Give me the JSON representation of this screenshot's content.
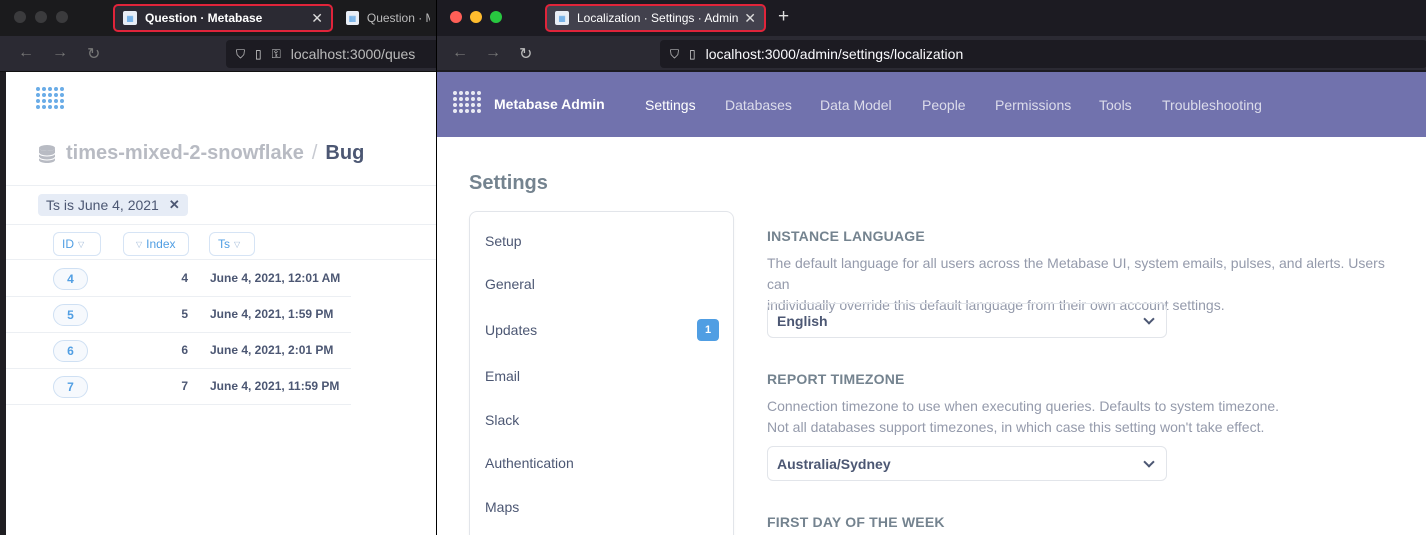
{
  "back_window": {
    "tabs": [
      {
        "label": "Question · Metabase",
        "active": true
      },
      {
        "label": "Question · M",
        "active": false
      }
    ],
    "url": "localhost:3000/ques",
    "breadcrumb": {
      "database": "times-mixed-2-snowflake",
      "separator": "/",
      "question": "Bug"
    },
    "filter": {
      "label": "Ts is June 4, 2021",
      "remove": "✕"
    },
    "columns": [
      {
        "label": "ID"
      },
      {
        "label": "Index"
      },
      {
        "label": "Ts"
      }
    ],
    "rows": [
      {
        "id": "4",
        "index": "4",
        "ts": "June 4, 2021, 12:01 AM"
      },
      {
        "id": "5",
        "index": "5",
        "ts": "June 4, 2021, 1:59 PM"
      },
      {
        "id": "6",
        "index": "6",
        "ts": "June 4, 2021, 2:01 PM"
      },
      {
        "id": "7",
        "index": "7",
        "ts": "June 4, 2021, 11:59 PM"
      }
    ]
  },
  "front_window": {
    "tab": {
      "label": "Localization · Settings · Admin ·",
      "close": "✕"
    },
    "new_tab": "+",
    "url": "localhost:3000/admin/settings/localization",
    "header": {
      "title": "Metabase Admin",
      "nav": [
        "Settings",
        "Databases",
        "Data Model",
        "People",
        "Permissions",
        "Tools",
        "Troubleshooting"
      ],
      "active_nav": "Settings"
    },
    "page_title": "Settings",
    "sidebar": [
      {
        "label": "Setup"
      },
      {
        "label": "General"
      },
      {
        "label": "Updates",
        "badge": "1"
      },
      {
        "label": "Email"
      },
      {
        "label": "Slack"
      },
      {
        "label": "Authentication"
      },
      {
        "label": "Maps"
      }
    ],
    "sections": {
      "language": {
        "title": "INSTANCE LANGUAGE",
        "desc1": "The default language for all users across the Metabase UI, system emails, pulses, and alerts. Users can",
        "desc2": "individually override this default language from their own account settings.",
        "value": "English"
      },
      "timezone": {
        "title": "REPORT TIMEZONE",
        "desc1": "Connection timezone to use when executing queries. Defaults to system timezone.",
        "desc2": "Not all databases support timezones, in which case this setting won't take effect.",
        "value": "Australia/Sydney"
      },
      "week": {
        "title": "FIRST DAY OF THE WEEK"
      }
    }
  },
  "colors": {
    "brand": "#509ee3",
    "admin_header": "#7172ad",
    "tab_highlight": "#e0243a"
  }
}
